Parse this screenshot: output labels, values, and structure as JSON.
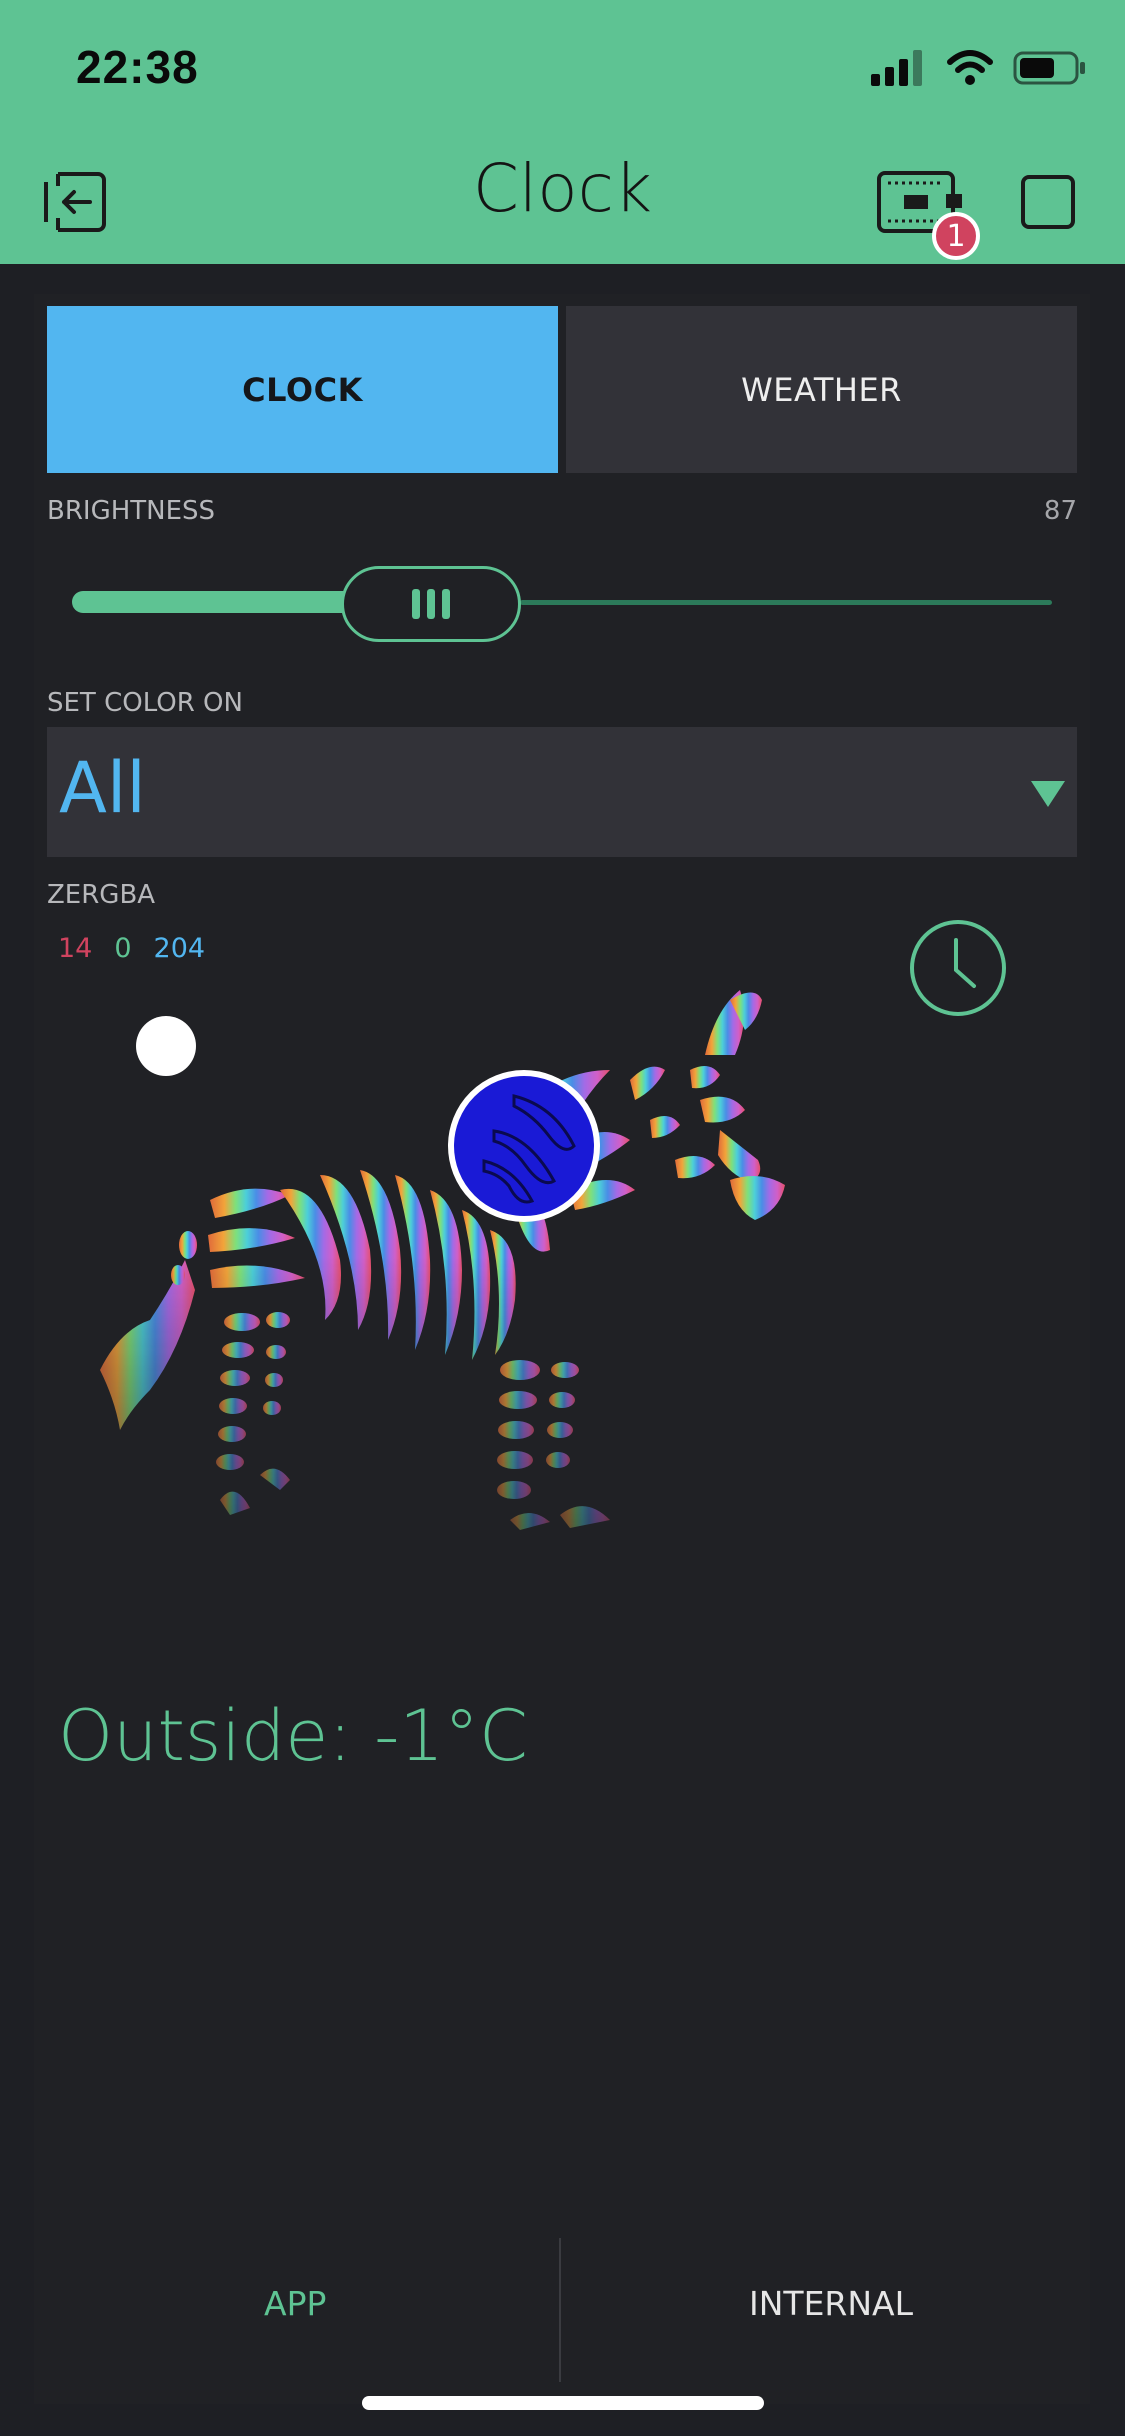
{
  "status_bar": {
    "time": "22:38"
  },
  "header": {
    "title": "Clock",
    "device_badge_count": "1"
  },
  "tabs": [
    {
      "label": "CLOCK",
      "active": true
    },
    {
      "label": "WEATHER",
      "active": false
    }
  ],
  "brightness": {
    "label": "BRIGHTNESS",
    "value": "87",
    "level_fraction": 0.4
  },
  "set_color": {
    "label": "SET COLOR ON",
    "selected": "All"
  },
  "zergba": {
    "label": "ZERGBA",
    "r": "14",
    "g": "0",
    "b": "204",
    "selected_color": "#0e00cc"
  },
  "weather": {
    "outside_text": "Outside: -1°C"
  },
  "bottom_tabs": [
    {
      "label": "APP",
      "active": true
    },
    {
      "label": "INTERNAL",
      "active": false
    }
  ],
  "colors": {
    "accent_green": "#5ec393",
    "accent_blue": "#52b6f0",
    "background": "#1e1f24",
    "red_value": "#d0435f"
  }
}
